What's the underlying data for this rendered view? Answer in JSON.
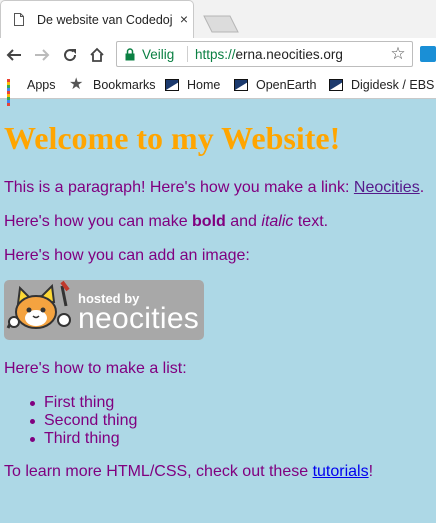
{
  "tab": {
    "title": "De website van Codedojo",
    "close_glyph": "×"
  },
  "toolbar": {
    "secure_label": "Veilig",
    "url_scheme": "https://",
    "url_host": "erna.neocities.org"
  },
  "bookmarks": [
    {
      "label": "Apps",
      "icon": "apps-grid-icon"
    },
    {
      "label": "Bookmarks",
      "icon": "star-icon"
    },
    {
      "label": "Home",
      "icon": "flag-icon"
    },
    {
      "label": "OpenEarth",
      "icon": "flag-icon"
    },
    {
      "label": "Digidesk / EBS",
      "icon": "flag-icon"
    }
  ],
  "page": {
    "heading": "Welcome to my Website!",
    "p1_text": "This is a paragraph! Here's how you make a link: ",
    "p1_link": "Neocities",
    "p1_end": ".",
    "p2_start": "Here's how you can make ",
    "p2_bold": "bold",
    "p2_mid": " and ",
    "p2_italic": "italic",
    "p2_end": " text.",
    "p3": "Here's how you can add an image:",
    "badge_hosted": "hosted by",
    "badge_neocities": "neocities",
    "p4": "Here's how to make a list:",
    "list": [
      "First thing",
      "Second thing",
      "Third thing"
    ],
    "p5_text": "To learn more HTML/CSS, check out these ",
    "p5_link": "tutorials",
    "p5_end": "!"
  },
  "colors": {
    "page_bg": "#add8e6",
    "heading": "#ffa500",
    "text": "#800080",
    "link": "#0000ee",
    "visited_link": "#551a8b",
    "secure_green": "#0b8043"
  }
}
